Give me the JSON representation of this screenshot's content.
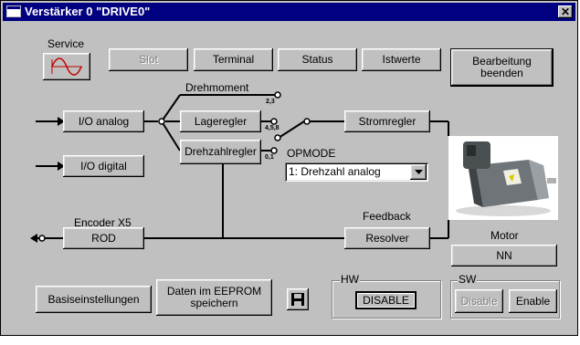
{
  "window": {
    "title": "Verstärker 0 \"DRIVE0\"",
    "close_glyph": "✕"
  },
  "service": {
    "label": "Service",
    "icon": "sine-wave-icon"
  },
  "toolbar": {
    "slot": "Slot",
    "terminal": "Terminal",
    "status": "Status",
    "istwerte": "Istwerte",
    "bearbeitung_line1": "Bearbeitung",
    "bearbeitung_line2": "beenden"
  },
  "diagram": {
    "drehmoment": "Drehmoment",
    "io_analog": "I/O analog",
    "io_digital": "I/O digital",
    "lageregler": "Lageregler",
    "drehzahlregler": "Drehzahlregler",
    "stromregler": "Stromregler",
    "opmode_label": "OPMODE",
    "opmode_value": "1: Drehzahl analog",
    "tag_23": "2,3",
    "tag_458": "4,5,8",
    "tag_01": "0,1",
    "encoder_label": "Encoder X5",
    "rod": "ROD",
    "feedback_label": "Feedback",
    "resolver": "Resolver",
    "motor_label": "Motor",
    "motor_value": "NN"
  },
  "bottom": {
    "basis": "Basiseinstellungen",
    "eeprom_line1": "Daten im EEPROM",
    "eeprom_line2": "speichern",
    "save_icon": "floppy-disk-icon",
    "hw_title": "HW",
    "hw_status": "DISABLE",
    "sw_title": "SW",
    "sw_disable": "Disable",
    "sw_enable": "Enable"
  },
  "colors": {
    "titlebar": "#000080",
    "face": "#c0c0c0"
  }
}
